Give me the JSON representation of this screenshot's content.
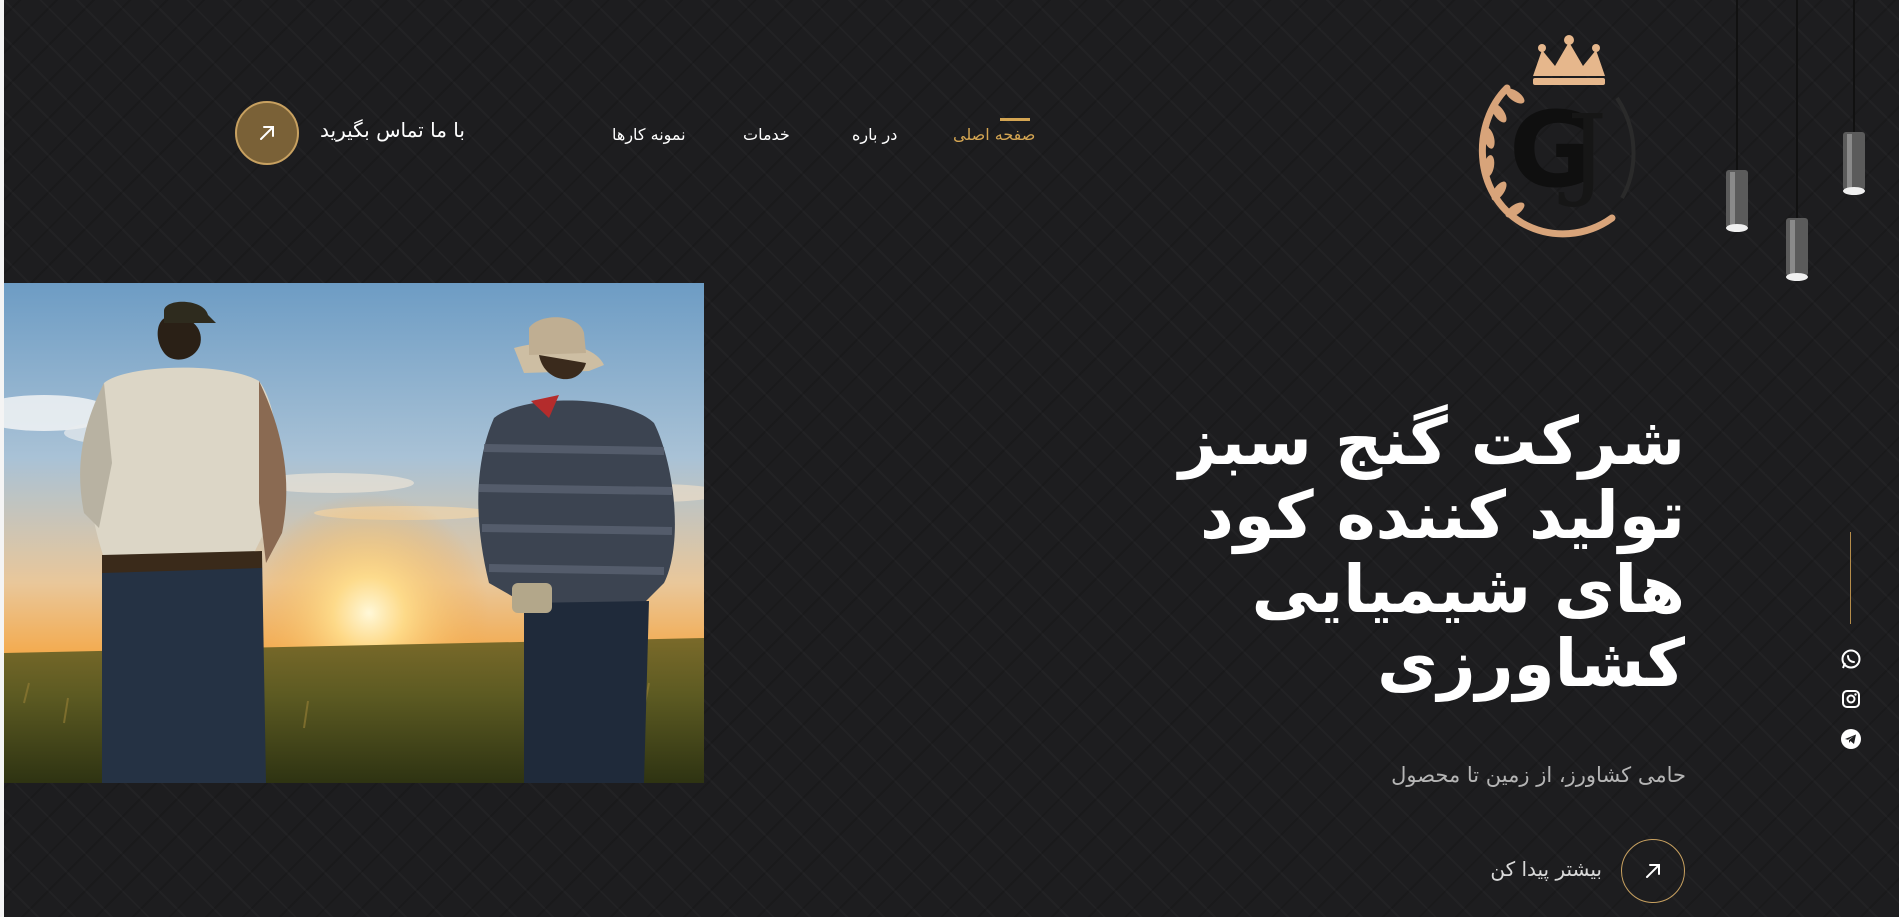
{
  "header": {
    "contact_label": "با ما تماس بگیرید",
    "nav": [
      {
        "label": "صفحه اصلی",
        "active": true
      },
      {
        "label": "در باره",
        "active": false
      },
      {
        "label": "خدمات",
        "active": false
      },
      {
        "label": "نمونه کارها",
        "active": false
      }
    ],
    "logo_text": "GJ",
    "icons": {
      "contact": "arrow-up-right-icon"
    }
  },
  "hero": {
    "title_lines": [
      "شرکت گنج سبز",
      "تولید کننده کود",
      "های شیمیایی",
      "کشاورزی"
    ],
    "subtitle": "حامی کشاورز، از زمین تا محصول",
    "more_label": "بیشتر پیدا کن",
    "image": "two-farmers-sunset-field"
  },
  "social": [
    "whatsapp-icon",
    "instagram-icon",
    "telegram-icon"
  ],
  "colors": {
    "accent": "#d4a552",
    "background": "#1d1d1f",
    "contact_fill": "#7a6137"
  }
}
